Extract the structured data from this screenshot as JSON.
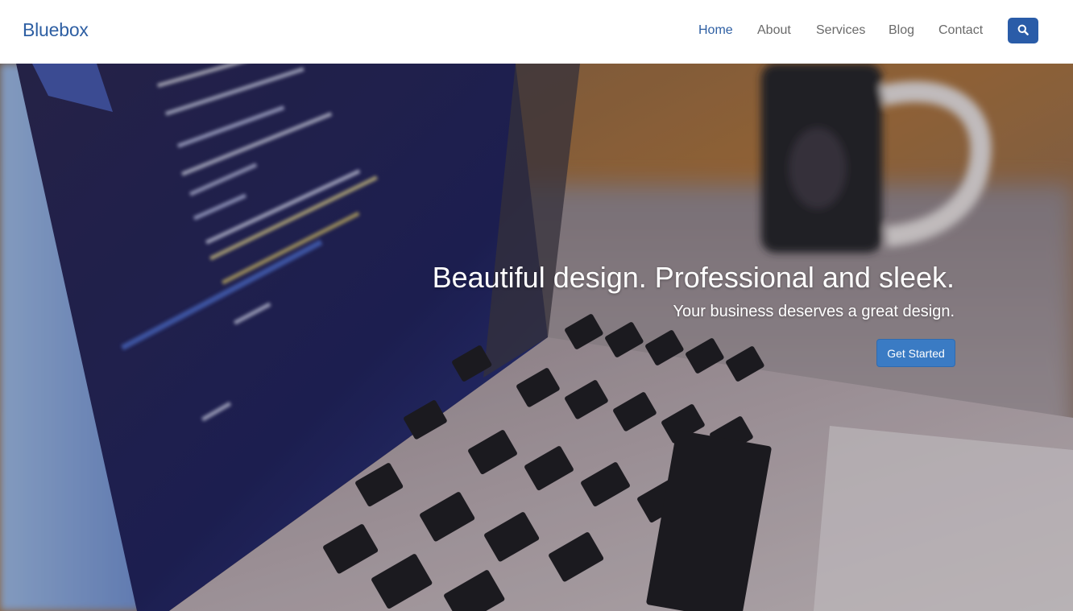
{
  "brand": {
    "name": "Bluebox",
    "color": "#2e5fa3"
  },
  "nav": {
    "items": [
      {
        "label": "Home",
        "active": true
      },
      {
        "label": "About",
        "active": false
      },
      {
        "label": "Services",
        "active": false
      },
      {
        "label": "Blog",
        "active": false
      },
      {
        "label": "Contact",
        "active": false
      }
    ],
    "search_icon": "search-icon"
  },
  "hero": {
    "title": "Beautiful design. Professional and sleek.",
    "subtitle": "Your business deserves a great design.",
    "cta_label": "Get Started",
    "background": "laptop-with-code-and-coffee-mug-photo"
  },
  "colors": {
    "accent": "#2a5ca8",
    "nav_active": "#2e5fa3",
    "nav_inactive": "#6a6a6a",
    "cta": "#3a7bc4"
  }
}
